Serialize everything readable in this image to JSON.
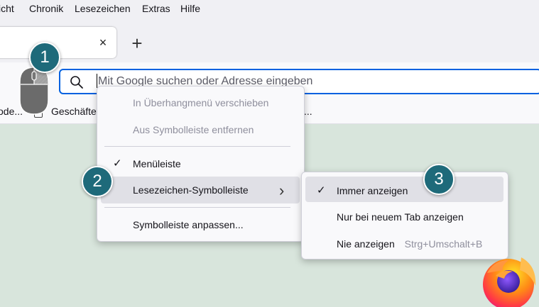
{
  "menubar": {
    "items": [
      "icht",
      "Chronik",
      "Lesezeichen",
      "Extras",
      "Hilfe"
    ]
  },
  "tab": {
    "close_glyph": "×"
  },
  "toolbar": {
    "new_tab_glyph": "+"
  },
  "urlbar": {
    "placeholder": "Mit Google suchen oder Adresse eingeben"
  },
  "bookmarks": {
    "items": [
      "ode...",
      "Geschäfte",
      "..."
    ]
  },
  "context_menu": {
    "items": [
      {
        "label": "In Überhangmenü verschieben",
        "enabled": false
      },
      {
        "label": "Aus Symbolleiste entfernen",
        "enabled": false
      },
      {
        "label": "Menüleiste",
        "checked": true
      },
      {
        "label": "Lesezeichen-Symbolleiste",
        "has_submenu": true,
        "highlighted": true
      },
      {
        "label": "Symbolleiste anpassen..."
      }
    ],
    "check_glyph": "✓",
    "submenu_glyph": "›"
  },
  "submenu": {
    "items": [
      {
        "label": "Immer anzeigen",
        "checked": true,
        "highlighted": true
      },
      {
        "label": "Nur bei neuem Tab anzeigen"
      },
      {
        "label": "Nie anzeigen",
        "shortcut": "Strg+Umschalt+B"
      }
    ]
  },
  "steps": {
    "one": "1",
    "two": "2",
    "three": "3"
  },
  "icons": [
    "search-icon",
    "close-icon",
    "plus-icon",
    "mouse-right-click-icon",
    "checkmark-icon",
    "chevron-right-icon",
    "firefox-logo"
  ],
  "colors": {
    "badge": "#1e6a7a",
    "focus_ring": "#0061e0",
    "page_background": "#d8e5dc",
    "menu_background": "#f9f9fb",
    "highlight": "#e0e0e6"
  }
}
